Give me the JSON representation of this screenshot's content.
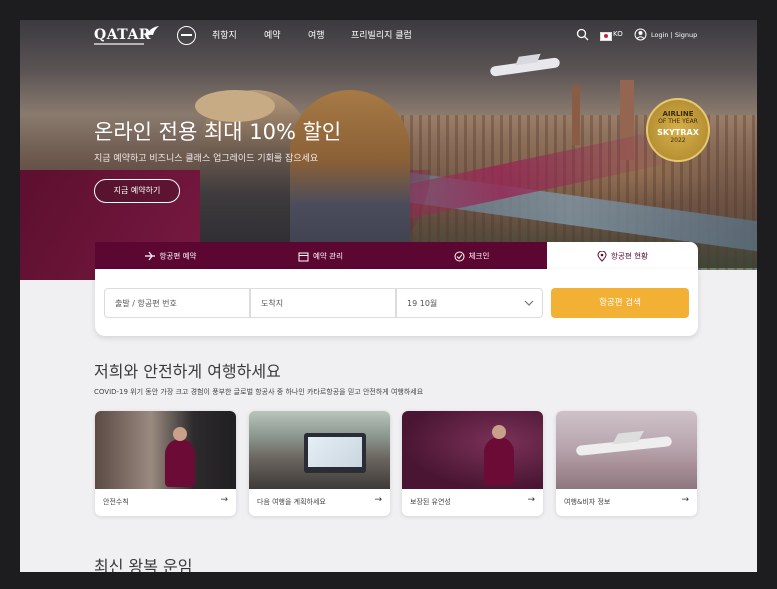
{
  "nav": {
    "logo": "QATAR",
    "items": [
      "취항지",
      "예약",
      "여행",
      "프리빌리지 클럽"
    ],
    "language": "KO",
    "login": "Login | Signup"
  },
  "hero": {
    "headline": "온라인 전용 최대 10% 할인",
    "subline": "지금 예약하고 비즈니스 클래스 업그레이드 기회를 잡으세요",
    "cta": "지금 예약하기",
    "award": {
      "line1": "AIRLINE",
      "line2": "OF THE YEAR",
      "brand": "SKYTRAX",
      "year": "2022"
    }
  },
  "booking": {
    "tabs": [
      "항공편 예약",
      "예약 관리",
      "체크인",
      "항공편 현황"
    ],
    "active_tab": 3,
    "fields": {
      "origin_placeholder": "출발 / 항공편 번호",
      "destination_placeholder": "도착지",
      "date_value": "19 10월"
    },
    "search_button": "항공편 검색"
  },
  "travel_section": {
    "title": "저희와 안전하게 여행하세요",
    "description": "COVID-19 위기 동안 가장 크고 경험이 풍부한 글로벌 항공사 중 하나인 카타르항공을 믿고 안전하게 여행하세요",
    "cards": [
      {
        "label": "안전수칙",
        "arrow": "→"
      },
      {
        "label": "다음 여행을 계획하세요",
        "arrow": "→"
      },
      {
        "label": "보장된 유연성",
        "arrow": "→"
      },
      {
        "label": "여행&비자 정보",
        "arrow": "→"
      }
    ]
  },
  "fares_section": {
    "title": "최신 왕복 운임"
  },
  "colors": {
    "brand": "#5c0632",
    "accent": "#f2b135"
  }
}
